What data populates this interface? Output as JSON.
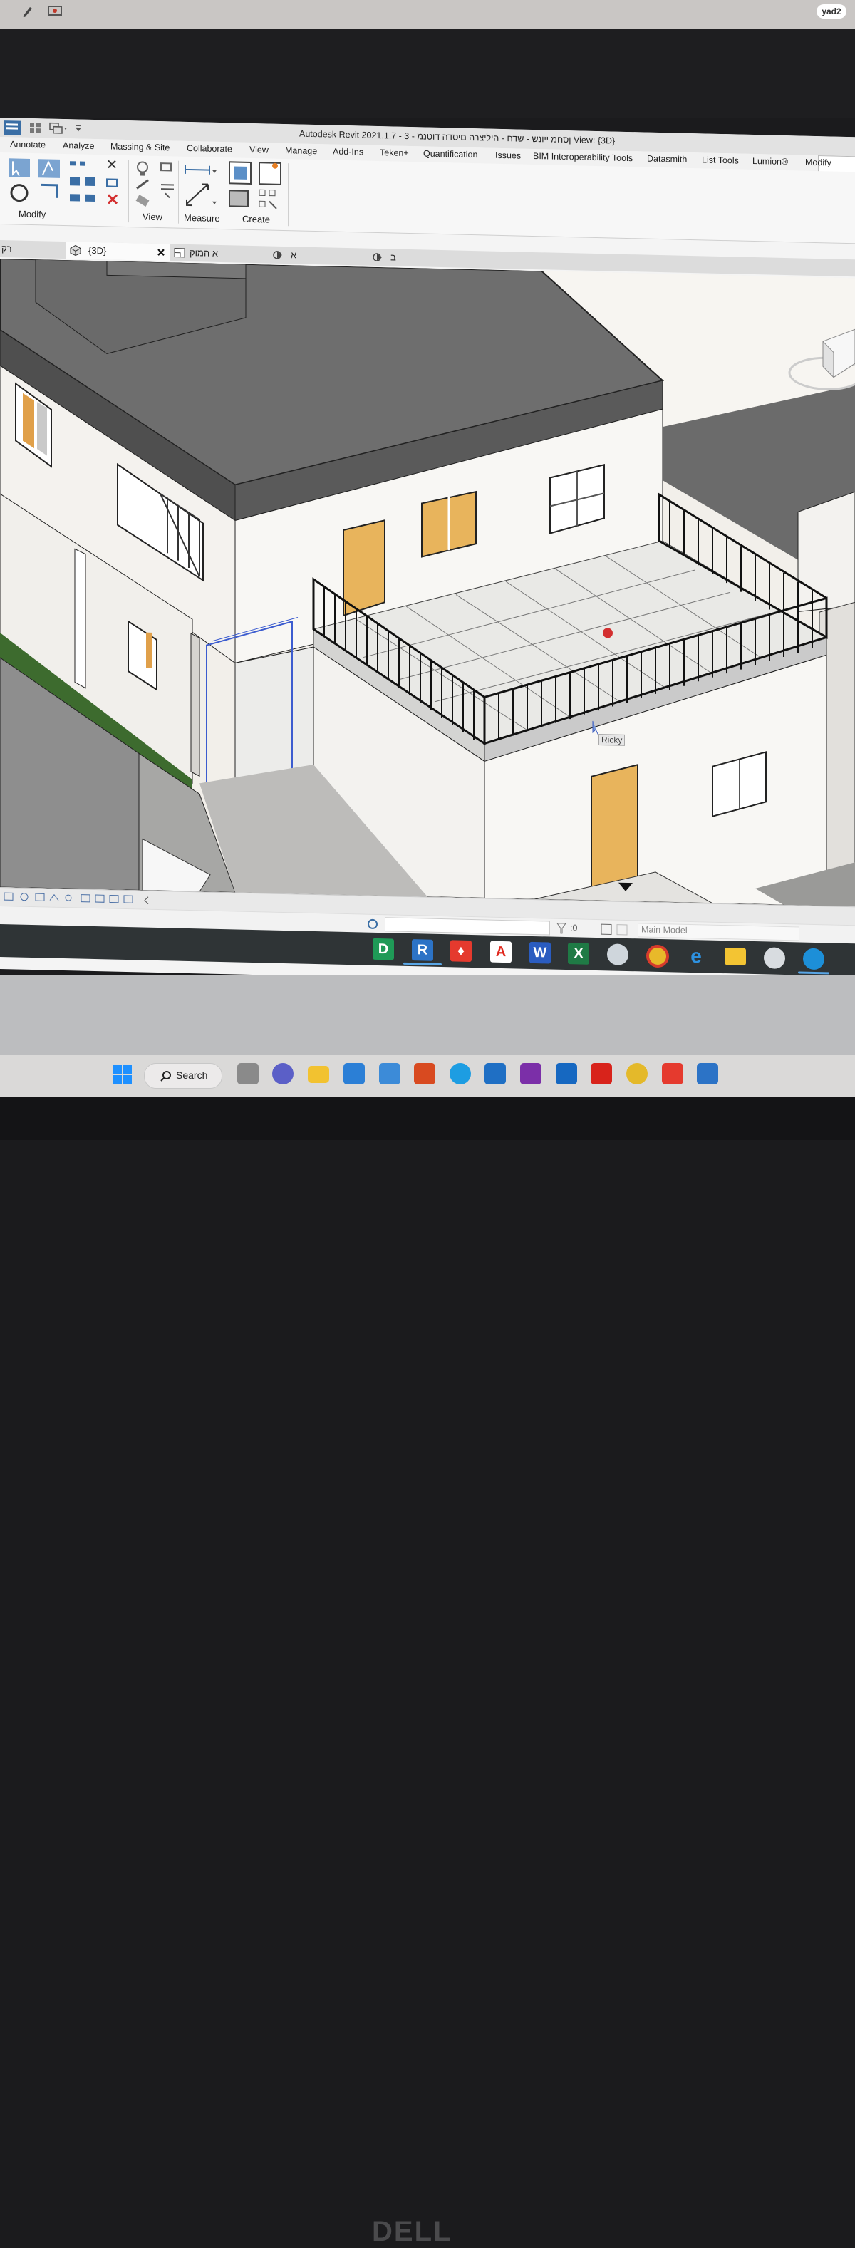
{
  "watermark": "yad2",
  "revit": {
    "window_title": "Autodesk Revit 2021.1.7 - 3 - ןסחמ ייונש - שדח - היליצרה םיסדה דוטנמ View: {3D}",
    "ribbon_tabs": [
      "Annotate",
      "Analyze",
      "Massing & Site",
      "Collaborate",
      "View",
      "Manage",
      "Add-Ins",
      "Teken+",
      "Quantification",
      "Issues",
      "BIM Interoperability Tools",
      "Datasmith",
      "List Tools",
      "Lumion®",
      "Modify"
    ],
    "active_tab": "Modify",
    "panels": [
      "Modify",
      "View",
      "Measure",
      "Create"
    ],
    "view_tabs": [
      {
        "label": "רק",
        "active": false
      },
      {
        "label": "{3D}",
        "active": true
      },
      {
        "label": "א המוק",
        "active": false
      },
      {
        "label": "א",
        "active": false
      },
      {
        "label": "ב",
        "active": false
      }
    ],
    "cursor_tooltip": "Ricky",
    "status": {
      "selection_count": ":0",
      "model": "Main Model"
    }
  },
  "taskbar_apps": [
    {
      "icon": "dwg-viewer-icon",
      "letter": "D",
      "color": "#1f9a57"
    },
    {
      "icon": "revit-icon",
      "letter": "R",
      "color": "#2c73c6"
    },
    {
      "icon": "anydesk-icon",
      "letter": "",
      "color": "#e53a2e"
    },
    {
      "icon": "acrobat-icon",
      "letter": "A",
      "color": "#e0271c"
    },
    {
      "icon": "word-icon",
      "letter": "W",
      "color": "#2a5cc0"
    },
    {
      "icon": "excel-icon",
      "letter": "X",
      "color": "#1f7a45"
    },
    {
      "icon": "paint-icon",
      "letter": "",
      "color": "#cfd6dc"
    },
    {
      "icon": "chrome-icon",
      "letter": "",
      "color": "#e8b92a"
    },
    {
      "icon": "internet-explorer-icon",
      "letter": "e",
      "color": "#2d91e0"
    },
    {
      "icon": "file-explorer-icon",
      "letter": "",
      "color": "#f3c433"
    },
    {
      "icon": "paint-3d-icon",
      "letter": "",
      "color": "#d8dce0"
    },
    {
      "icon": "edge-icon",
      "letter": "",
      "color": "#1d8fd8"
    }
  ],
  "win11": {
    "search_label": "Search",
    "apps": [
      {
        "icon": "windows-start-icon",
        "color": "#1e90ff"
      },
      {
        "icon": "task-view-icon",
        "color": "#8a8a8a"
      },
      {
        "icon": "teams-icon",
        "color": "#5b5fc7"
      },
      {
        "icon": "file-explorer-icon",
        "color": "#f2c230"
      },
      {
        "icon": "mail-icon",
        "color": "#2b7fd6"
      },
      {
        "icon": "store-icon",
        "color": "#3c8bd8"
      },
      {
        "icon": "office-icon",
        "color": "#d84a20"
      },
      {
        "icon": "edge-icon",
        "color": "#1d9de2"
      },
      {
        "icon": "lync-icon",
        "color": "#1f6fc4"
      },
      {
        "icon": "onenote-icon",
        "color": "#7b2fa8"
      },
      {
        "icon": "outlook-icon",
        "color": "#1668c1"
      },
      {
        "icon": "acrobat-icon",
        "color": "#d8231b"
      },
      {
        "icon": "chrome-icon",
        "color": "#e4b92a"
      },
      {
        "icon": "anydesk-icon",
        "color": "#e53a2e"
      },
      {
        "icon": "revit-icon",
        "color": "#2c73c6"
      }
    ]
  },
  "monitor_brand": "DELL"
}
